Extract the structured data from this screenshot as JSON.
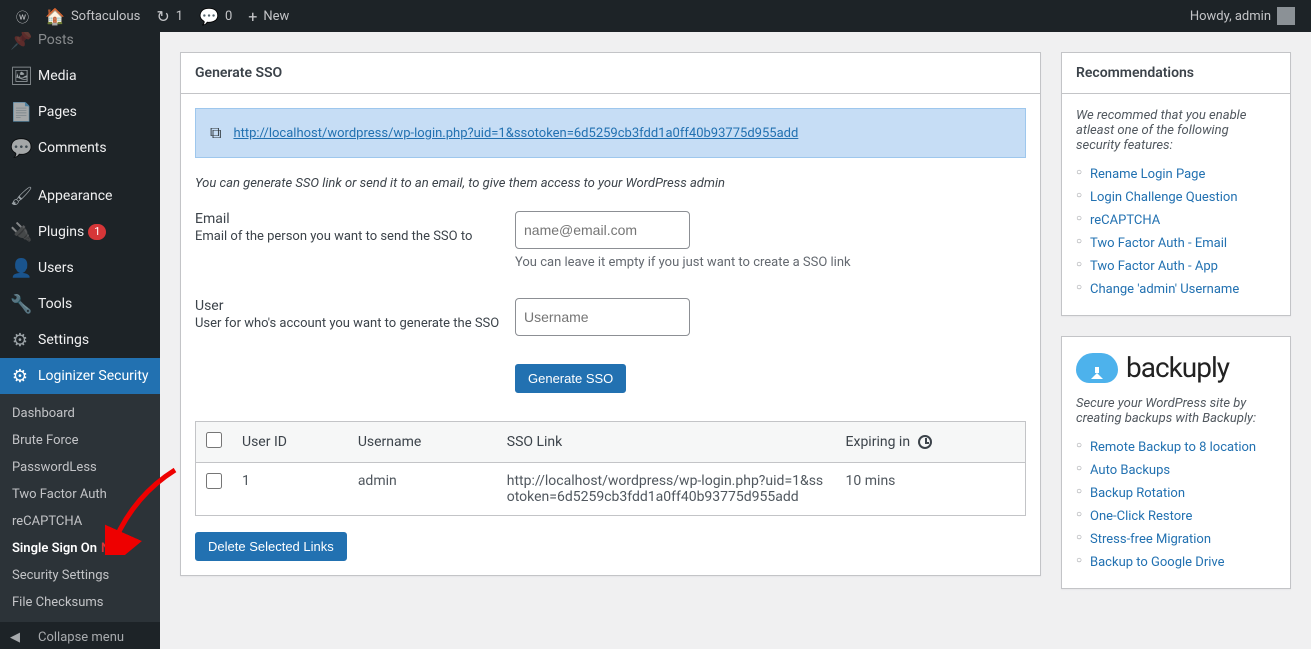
{
  "adminbar": {
    "site_name": "Softaculous",
    "updates_count": "1",
    "comments_count": "0",
    "new_label": "New",
    "howdy": "Howdy, admin"
  },
  "sidebar": {
    "items": [
      {
        "icon": "📌",
        "label": "Posts"
      },
      {
        "icon": "🎥",
        "label": "Media"
      },
      {
        "icon": "📄",
        "label": "Pages"
      },
      {
        "icon": "💬",
        "label": "Comments"
      },
      {
        "icon": "🖌",
        "label": "Appearance"
      },
      {
        "icon": "🔌",
        "label": "Plugins",
        "badge": "1"
      },
      {
        "icon": "👤",
        "label": "Users"
      },
      {
        "icon": "🔧",
        "label": "Tools"
      },
      {
        "icon": "⚙",
        "label": "Settings"
      },
      {
        "icon": "⚙",
        "label": "Loginizer Security"
      }
    ],
    "submenu": [
      {
        "label": "Dashboard"
      },
      {
        "label": "Brute Force"
      },
      {
        "label": "PasswordLess"
      },
      {
        "label": "Two Factor Auth"
      },
      {
        "label": "reCAPTCHA"
      },
      {
        "label": "Single Sign On",
        "new": "New",
        "active": true
      },
      {
        "label": "Security Settings"
      },
      {
        "label": "File Checksums"
      }
    ],
    "collapse": "Collapse menu"
  },
  "main": {
    "panel_title": "Generate SSO",
    "sso_url": "http://localhost/wordpress/wp-login.php?uid=1&ssotoken=6d5259cb3fdd1a0ff40b93775d955add",
    "desc": "You can generate SSO link or send it to an email, to give them access to your WordPress admin",
    "email_label": "Email",
    "email_help": "Email of the person you want to send the SSO to",
    "email_placeholder": "name@email.com",
    "email_hint": "You can leave it empty if you just want to create a SSO link",
    "user_label": "User",
    "user_help": "User for who's account you want to generate the SSO",
    "user_placeholder": "Username",
    "generate_btn": "Generate SSO",
    "table": {
      "headers": [
        "User ID",
        "Username",
        "SSO Link",
        "Expiring in"
      ],
      "rows": [
        {
          "user_id": "1",
          "username": "admin",
          "sso_link": "http://localhost/wordpress/wp-login.php?uid=1&ssotoken=6d5259cb3fdd1a0ff40b93775d955add",
          "expiring": "10 mins"
        }
      ]
    },
    "delete_btn": "Delete Selected Links"
  },
  "recommendations": {
    "title": "Recommendations",
    "desc": "We recommed that you enable atleast one of the following security features:",
    "items": [
      "Rename Login Page",
      "Login Challenge Question",
      "reCAPTCHA",
      "Two Factor Auth - Email",
      "Two Factor Auth - App",
      "Change 'admin' Username"
    ]
  },
  "backuply": {
    "name": "backuply",
    "desc": "Secure your WordPress site by creating backups with Backuply:",
    "items": [
      "Remote Backup to 8 location",
      "Auto Backups",
      "Backup Rotation",
      "One-Click Restore",
      "Stress-free Migration",
      "Backup to Google Drive"
    ]
  }
}
